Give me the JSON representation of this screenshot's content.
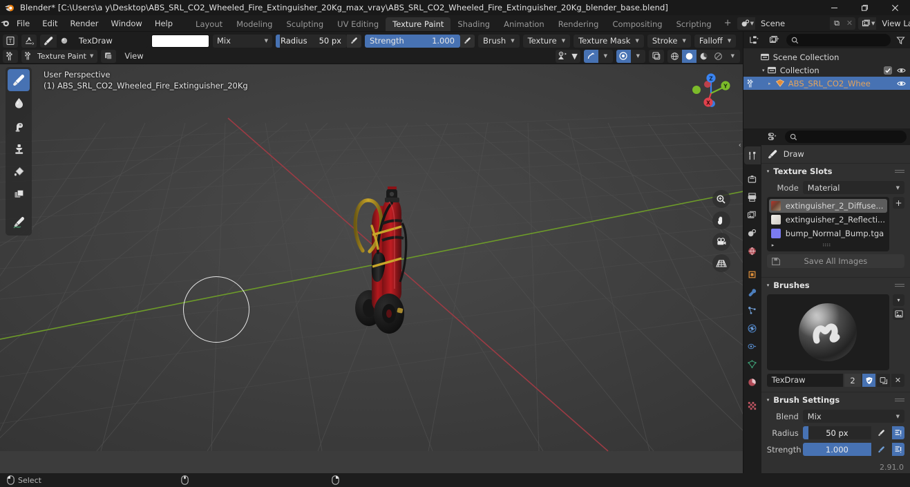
{
  "window": {
    "title": "Blender* [C:\\Users\\a y\\Desktop\\ABS_SRL_CO2_Wheeled_Fire_Extinguisher_20Kg_max_vray\\ABS_SRL_CO2_Wheeled_Fire_Extinguisher_20Kg_blender_base.blend]",
    "minimize": "—",
    "maximize": "❐",
    "close": "✕"
  },
  "topbar": {
    "menus": [
      "File",
      "Edit",
      "Render",
      "Window",
      "Help"
    ],
    "workspaces": [
      {
        "label": "Layout",
        "active": false
      },
      {
        "label": "Modeling",
        "active": false
      },
      {
        "label": "Sculpting",
        "active": false
      },
      {
        "label": "UV Editing",
        "active": false
      },
      {
        "label": "Texture Paint",
        "active": true
      },
      {
        "label": "Shading",
        "active": false
      },
      {
        "label": "Animation",
        "active": false
      },
      {
        "label": "Rendering",
        "active": false
      },
      {
        "label": "Compositing",
        "active": false
      },
      {
        "label": "Scripting",
        "active": false
      }
    ],
    "add_workspace": "+",
    "scene": {
      "name": "Scene",
      "icon": "scene-icon",
      "new_label": "⧉",
      "unlink_label": "✕"
    },
    "view_layer": {
      "name": "View Layer",
      "icon": "view-layer-icon",
      "new_label": "⧉",
      "unlink_label": "✕"
    }
  },
  "tool_header": {
    "editor_type_icon": "texture-paint-editor-icon",
    "tool_preset_icon": "tool-preset-icon",
    "brush_icon": "brush-icon",
    "brush_data_icon": "brush-data-icon",
    "brush_name": "TexDraw",
    "color": "#ffffff",
    "blend": {
      "label": "Mix",
      "chev": "▼"
    },
    "radius": {
      "label": "Radius",
      "value": "50 px",
      "fill_pct": 6
    },
    "strength": {
      "label": "Strength",
      "value": "1.000",
      "fill_pct": 100
    },
    "popovers": [
      "Brush",
      "Texture",
      "Texture Mask",
      "Stroke",
      "Falloff"
    ],
    "mode": {
      "label": "Texture Paint",
      "chev": "▼"
    },
    "view_menu": "View",
    "overlay_chev": "▼",
    "snap_chev": "▼",
    "proportional_chev": "▼",
    "shading_chev": "▼"
  },
  "viewport": {
    "perspective": "User Perspective",
    "object_line": "(1) ABS_SRL_CO2_Wheeled_Fire_Extinguisher_20Kg",
    "gizmo_axes": [
      {
        "label": "Z",
        "color": "#3a84f2"
      },
      {
        "label": "Y",
        "color": "#7cbb2a"
      },
      {
        "label": "X",
        "color": "#e0414d"
      }
    ],
    "side_buttons": [
      "zoom-icon",
      "pan-hand-icon",
      "camera-perspective-icon",
      "grid-toggle-icon"
    ],
    "collapse_arrow": "‹",
    "tools": [
      {
        "name": "tool-draw",
        "active": true
      },
      {
        "name": "tool-soften",
        "active": false
      },
      {
        "name": "tool-smear",
        "active": false
      },
      {
        "name": "tool-clone",
        "active": false
      },
      {
        "name": "tool-fill",
        "active": false
      },
      {
        "name": "tool-mask",
        "active": false
      },
      {
        "name": "tool-annotate",
        "active": false
      }
    ]
  },
  "outliner": {
    "display_mode_icon": "outliner-display-mode-icon",
    "filter_id_icon": "filter-id-icon",
    "search_icon": "search-icon",
    "search_placeholder": "",
    "filter_icon": "funnel-icon",
    "rows": [
      {
        "name": "Scene Collection",
        "indent": 0,
        "icon": "collection-icon",
        "disclosure": "",
        "selected": false,
        "checkbox": false,
        "eye": false,
        "color": "#d8d8d8"
      },
      {
        "name": "Collection",
        "indent": 1,
        "icon": "collection-icon",
        "disclosure": "▾",
        "selected": false,
        "checkbox": true,
        "eye": true,
        "color": "#d8d8d8"
      },
      {
        "name": "ABS_SRL_CO2_Whee",
        "indent": 2,
        "icon": "mesh-object-icon",
        "disclosure": "▸",
        "selected": true,
        "checkbox": false,
        "eye": true,
        "color": "#e3a35c"
      }
    ]
  },
  "properties": {
    "editor_icon": "properties-editor-icon",
    "search_placeholder": "",
    "tabs": [
      {
        "name": "tool",
        "active": true
      },
      {
        "name": "render",
        "active": false
      },
      {
        "name": "output",
        "active": false
      },
      {
        "name": "view-layer",
        "active": false
      },
      {
        "name": "scene",
        "active": false
      },
      {
        "name": "world",
        "active": false
      },
      {
        "name": "object",
        "active": false
      },
      {
        "name": "modifiers",
        "active": false
      },
      {
        "name": "particles",
        "active": false
      },
      {
        "name": "physics",
        "active": false
      },
      {
        "name": "constraints",
        "active": false
      },
      {
        "name": "object-data",
        "active": false
      },
      {
        "name": "material",
        "active": false
      },
      {
        "name": "texture",
        "active": false
      }
    ],
    "breadcrumb": {
      "icon": "brush-icon",
      "label": "Draw"
    },
    "texture_slots": {
      "title": "Texture Slots",
      "tri": "▾",
      "mode_label": "Mode",
      "mode_value": "Material",
      "mode_chev": "▼",
      "add_label": "+",
      "expand_arrow": "▸",
      "slots": [
        {
          "label": "extinguisher_2_Diffuse...",
          "thumb": "#8a3b2c",
          "selected": true
        },
        {
          "label": "extinguisher_2_Reflecti...",
          "thumb": "#e8e6e0",
          "selected": false
        },
        {
          "label": "bump_Normal_Bump.tga",
          "thumb": "#7b7bf0",
          "selected": false
        }
      ],
      "save_all_label": "Save All Images",
      "save_all_icon": "save-image-icon"
    },
    "brushes": {
      "title": "Brushes",
      "tri": "▾",
      "preview_name": "brush-preview-sphere",
      "browse_chev": "▾",
      "new_icon": "new-image-icon",
      "id_name": "TexDraw",
      "users_count": "2",
      "fake_user_icon": "shield-icon",
      "duplicate_icon": "⧉",
      "unlink_icon": "✕"
    },
    "brush_settings": {
      "title": "Brush Settings",
      "tri": "▾",
      "blend_label": "Blend",
      "blend_value": "Mix",
      "blend_chev": "▼",
      "radius_label": "Radius",
      "radius_value": "50 px",
      "radius_fill_pct": 8,
      "strength_label": "Strength",
      "strength_value": "1.000",
      "strength_fill_pct": 100,
      "pressure_icon": "pressure-pen-icon",
      "unified_icon": "unified-settings-icon"
    },
    "version": "2.91.0"
  },
  "statusbar": {
    "items": [
      {
        "icon": "mouse-left-icon",
        "label": "Select"
      },
      {
        "icon": "mouse-middle-icon",
        "label": ""
      },
      {
        "icon": "mouse-right-icon",
        "label": ""
      }
    ]
  }
}
